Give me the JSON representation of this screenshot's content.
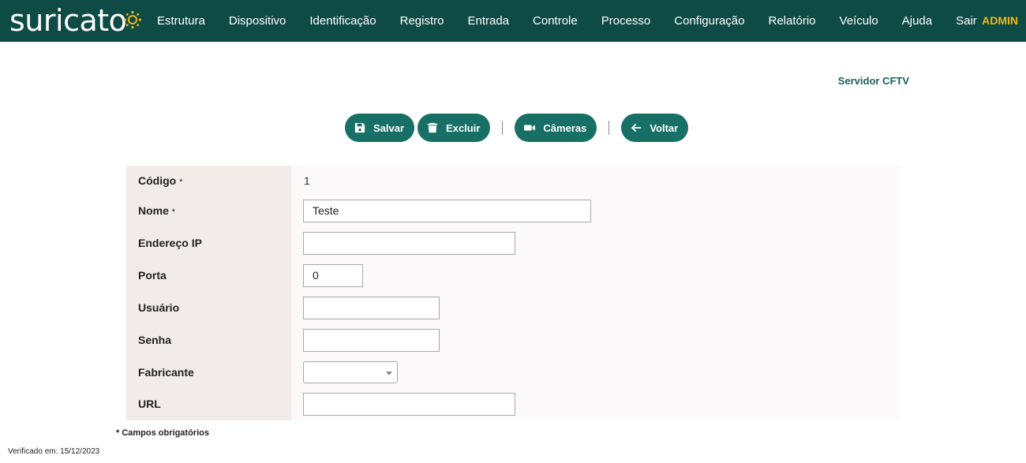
{
  "brand": {
    "logo_text": "suricato"
  },
  "nav": {
    "items": [
      "Estrutura",
      "Dispositivo",
      "Identificação",
      "Registro",
      "Entrada",
      "Controle",
      "Processo",
      "Configuração",
      "Relatório",
      "Veículo",
      "Ajuda",
      "Sair"
    ],
    "user": "ADMIN"
  },
  "page": {
    "title": "Servidor CFTV"
  },
  "toolbar": {
    "save_label": "Salvar",
    "delete_label": "Excluir",
    "cameras_label": "Câmeras",
    "back_label": "Voltar"
  },
  "form": {
    "codigo": {
      "label": "Código",
      "required_mark": "*",
      "value": "1"
    },
    "nome": {
      "label": "Nome",
      "required_mark": "*",
      "value": "Teste"
    },
    "endereco_ip": {
      "label": "Endereço IP",
      "value": ""
    },
    "porta": {
      "label": "Porta",
      "value": "0"
    },
    "usuario": {
      "label": "Usuário",
      "value": ""
    },
    "senha": {
      "label": "Senha",
      "value": ""
    },
    "fabricante": {
      "label": "Fabricante",
      "value": ""
    },
    "url": {
      "label": "URL",
      "value": ""
    }
  },
  "notes": {
    "required_fields": "* Campos obrigatórios"
  },
  "footer": {
    "verified": "Verificado em: 15/12/2023"
  },
  "colors": {
    "header_bg": "#0e4b45",
    "button_bg": "#176f66",
    "admin": "#f2b81c",
    "title": "#1d5f59"
  }
}
